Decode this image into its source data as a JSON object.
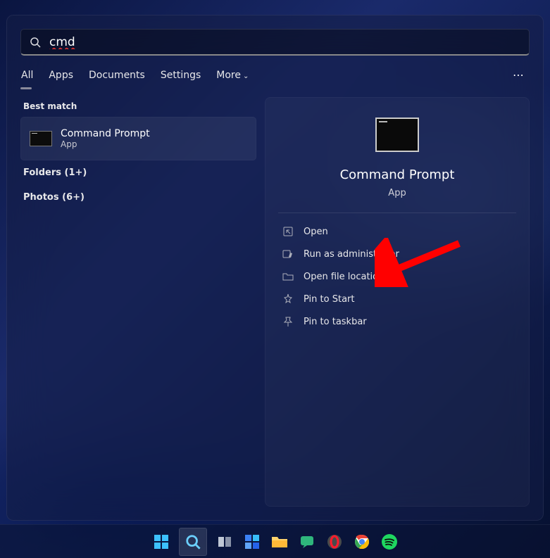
{
  "search": {
    "value": "cmd"
  },
  "tabs": {
    "items": [
      "All",
      "Apps",
      "Documents",
      "Settings",
      "More"
    ],
    "active_index": 0,
    "more_glyph": "⌄",
    "options_glyph": "⋯"
  },
  "left": {
    "best_match_label": "Best match",
    "result": {
      "title": "Command Prompt",
      "subtitle": "App"
    },
    "folders": {
      "label": "Folders (1+)"
    },
    "photos": {
      "label": "Photos (6+)"
    }
  },
  "preview": {
    "title": "Command Prompt",
    "subtitle": "App",
    "actions": [
      {
        "icon": "open-icon",
        "label": "Open"
      },
      {
        "icon": "admin-icon",
        "label": "Run as administrator"
      },
      {
        "icon": "folder-icon",
        "label": "Open file location"
      },
      {
        "icon": "pin-start-icon",
        "label": "Pin to Start"
      },
      {
        "icon": "pin-taskbar-icon",
        "label": "Pin to taskbar"
      }
    ]
  },
  "taskbar": {
    "items": [
      {
        "name": "start-button",
        "icon": "windows"
      },
      {
        "name": "search-button",
        "icon": "search",
        "active": true
      },
      {
        "name": "task-view-button",
        "icon": "taskview"
      },
      {
        "name": "widgets-button",
        "icon": "widgets"
      },
      {
        "name": "file-explorer-button",
        "icon": "explorer"
      },
      {
        "name": "chat-button",
        "icon": "chat"
      },
      {
        "name": "app-opera-button",
        "icon": "opera"
      },
      {
        "name": "app-chrome-button",
        "icon": "chrome"
      },
      {
        "name": "app-spotify-button",
        "icon": "spotify"
      }
    ]
  },
  "annotation": {
    "arrow_color": "#ff0000"
  }
}
